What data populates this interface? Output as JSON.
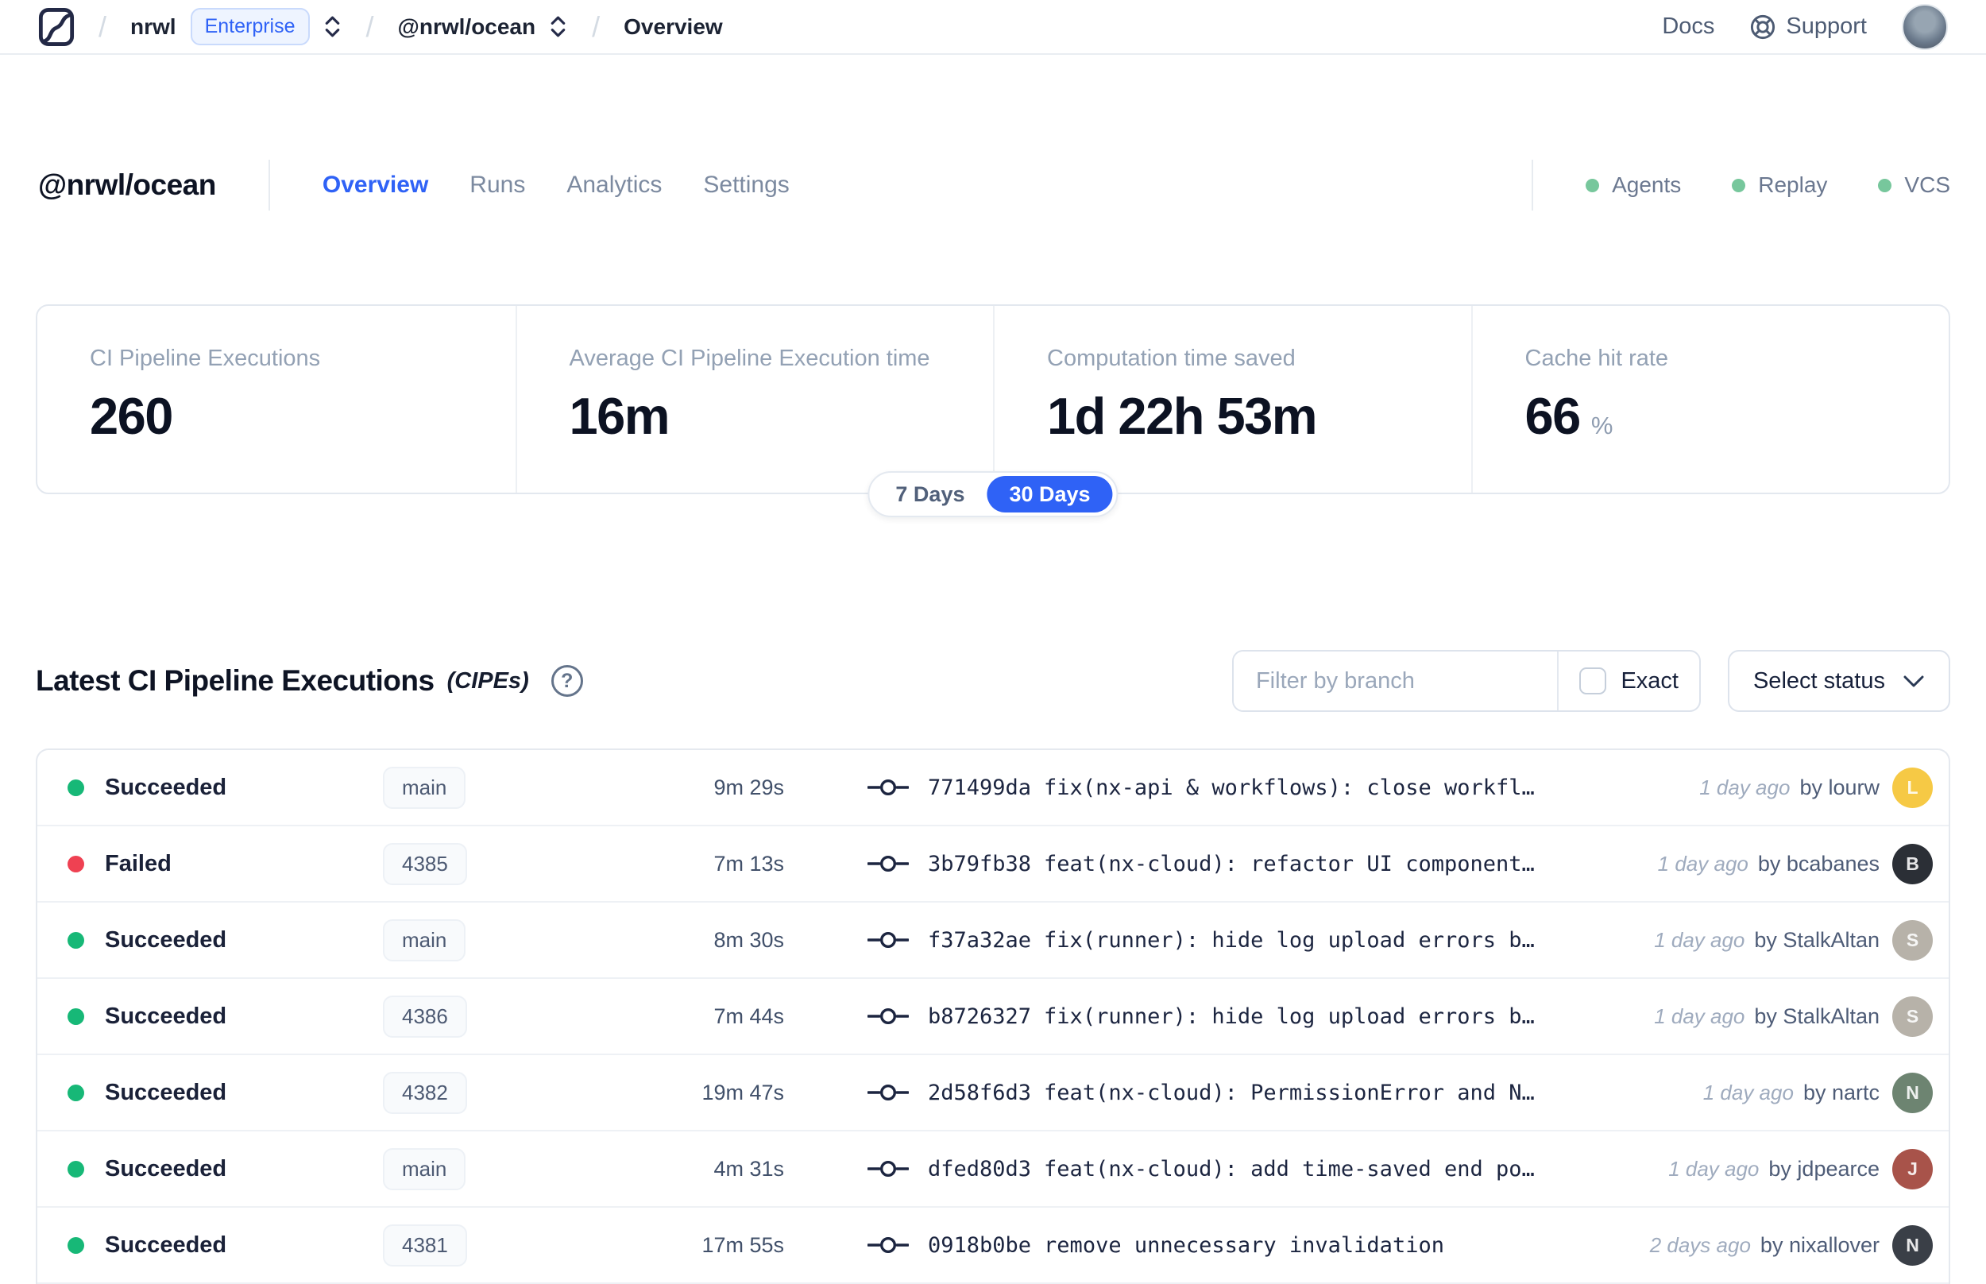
{
  "colors": {
    "accent": "#2f62f6",
    "success": "#17b877",
    "danger": "#ef4152",
    "header-dot": "#77c79c"
  },
  "navbar": {
    "org": "nrwl",
    "org_badge": "Enterprise",
    "workspace": "@nrwl/ocean",
    "page": "Overview",
    "docs_label": "Docs",
    "support_label": "Support"
  },
  "header": {
    "title": "@nrwl/ocean",
    "tabs": [
      {
        "label": "Overview",
        "active": true
      },
      {
        "label": "Runs",
        "active": false
      },
      {
        "label": "Analytics",
        "active": false
      },
      {
        "label": "Settings",
        "active": false
      }
    ],
    "statuses": [
      {
        "label": "Agents"
      },
      {
        "label": "Replay"
      },
      {
        "label": "VCS"
      }
    ]
  },
  "stats": {
    "cards": [
      {
        "label": "CI Pipeline Executions",
        "value": "260"
      },
      {
        "label": "Average CI Pipeline Execution time",
        "value": "16m"
      },
      {
        "label": "Computation time saved",
        "value": "1d 22h 53m"
      },
      {
        "label": "Cache hit rate",
        "value": "66",
        "suffix": "%"
      }
    ],
    "range": {
      "options": [
        "7 Days",
        "30 Days"
      ],
      "selected": "30 Days"
    }
  },
  "cipes": {
    "title": "Latest CI Pipeline Executions",
    "subtitle": "(CIPEs)",
    "help_glyph": "?",
    "filter": {
      "placeholder": "Filter by branch",
      "exact_label": "Exact",
      "status_label": "Select status"
    },
    "rows": [
      {
        "status": "Succeeded",
        "status_color": "success",
        "branch": "main",
        "duration": "9m 29s",
        "commit": "771499da",
        "message": "fix(nx-api & workflows): close workfl…",
        "time": "1 day ago",
        "author": "by lourw",
        "avatar_bg": "#f6c945",
        "avatar_text": "L"
      },
      {
        "status": "Failed",
        "status_color": "danger",
        "branch": "4385",
        "duration": "7m 13s",
        "commit": "3b79fb38",
        "message": "feat(nx-cloud): refactor UI component…",
        "time": "1 day ago",
        "author": "by bcabanes",
        "avatar_bg": "#2b2f36",
        "avatar_text": "B"
      },
      {
        "status": "Succeeded",
        "status_color": "success",
        "branch": "main",
        "duration": "8m 30s",
        "commit": "f37a32ae",
        "message": "fix(runner): hide log upload errors b…",
        "time": "1 day ago",
        "author": "by StalkAltan",
        "avatar_bg": "#b7b2a9",
        "avatar_text": "S"
      },
      {
        "status": "Succeeded",
        "status_color": "success",
        "branch": "4386",
        "duration": "7m 44s",
        "commit": "b8726327",
        "message": "fix(runner): hide log upload errors b…",
        "time": "1 day ago",
        "author": "by StalkAltan",
        "avatar_bg": "#b7b2a9",
        "avatar_text": "S"
      },
      {
        "status": "Succeeded",
        "status_color": "success",
        "branch": "4382",
        "duration": "19m 47s",
        "commit": "2d58f6d3",
        "message": "feat(nx-cloud): PermissionError and N…",
        "time": "1 day ago",
        "author": "by nartc",
        "avatar_bg": "#6d8471",
        "avatar_text": "N"
      },
      {
        "status": "Succeeded",
        "status_color": "success",
        "branch": "main",
        "duration": "4m 31s",
        "commit": "dfed80d3",
        "message": "feat(nx-cloud): add time-saved end po…",
        "time": "1 day ago",
        "author": "by jdpearce",
        "avatar_bg": "#a8534a",
        "avatar_text": "J"
      },
      {
        "status": "Succeeded",
        "status_color": "success",
        "branch": "4381",
        "duration": "17m 55s",
        "commit": "0918b0be",
        "message": "remove unnecessary invalidation",
        "time": "2 days ago",
        "author": "by nixallover",
        "avatar_bg": "#3a3f47",
        "avatar_text": "N"
      }
    ]
  }
}
